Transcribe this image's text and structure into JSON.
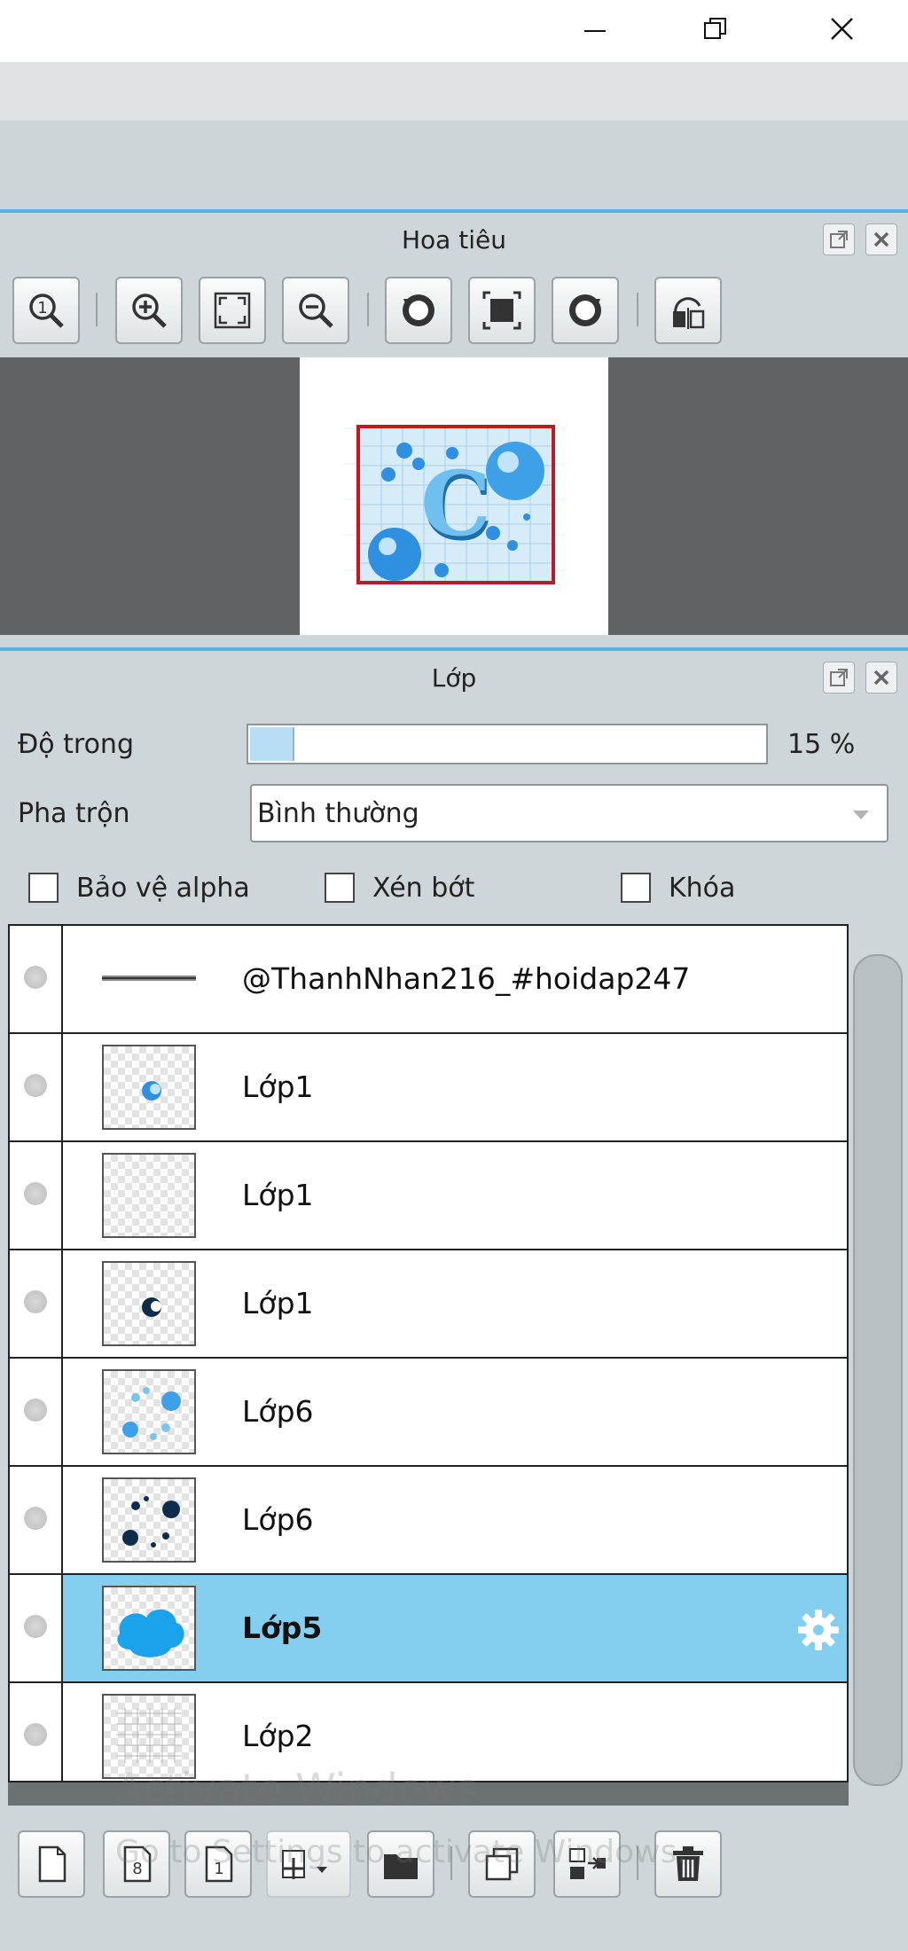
{
  "navigator": {
    "title": "Hoa tiêu",
    "toolbar": [
      "zoom-actual-icon",
      "zoom-in-icon",
      "fit-screen-icon",
      "zoom-out-icon",
      "rotate-left-icon",
      "fit-canvas-icon",
      "rotate-right-icon",
      "flip-horizontal-icon"
    ]
  },
  "layers": {
    "title": "Lớp",
    "opacity_label": "Độ trong",
    "opacity_value": "15 %",
    "opacity_fraction": 0.15,
    "blend_label": "Pha trộn",
    "blend_value": "Bình thường",
    "checkbox_protect_alpha": "Bảo vệ alpha",
    "checkbox_clip": "Xén bớt",
    "checkbox_lock": "Khóa",
    "items": [
      {
        "name": "@ThanhNhan216_#hoidap247",
        "selected": false
      },
      {
        "name": "Lớp1",
        "selected": false
      },
      {
        "name": "Lớp1",
        "selected": false
      },
      {
        "name": "Lớp1",
        "selected": false
      },
      {
        "name": "Lớp6",
        "selected": false
      },
      {
        "name": "Lớp6",
        "selected": false
      },
      {
        "name": "Lớp5",
        "selected": true
      },
      {
        "name": "Lớp2",
        "selected": false
      }
    ]
  },
  "watermark": {
    "line1": "Activate Windows",
    "line2": "Go to Settings to activate Windows."
  },
  "colors": {
    "accent": "#5ab3df",
    "selected_row": "#84cff0",
    "panel_bg": "#cfd6d9"
  }
}
